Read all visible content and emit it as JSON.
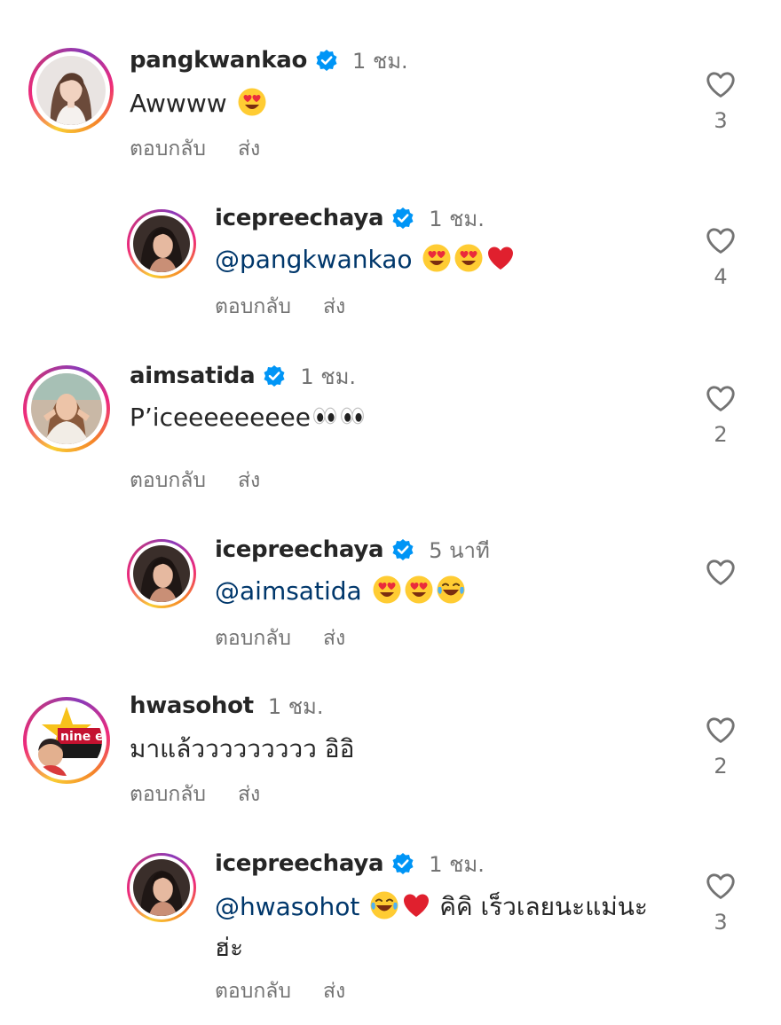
{
  "actions": {
    "reply": "ตอบกลับ",
    "send": "ส่ง"
  },
  "comments": [
    {
      "username": "pangkwankao",
      "verified": true,
      "time": "1 ชม.",
      "text": "Awwww",
      "emojis": [
        "heart-eyes"
      ],
      "likes": "3"
    },
    {
      "username": "icepreechaya",
      "verified": true,
      "time": "1 ชม.",
      "mention": "@pangkwankao",
      "emojis": [
        "heart-eyes",
        "heart-eyes",
        "red-heart"
      ],
      "likes": "4"
    },
    {
      "username": "aimsatida",
      "verified": true,
      "time": "1 ชม.",
      "text": "P’iceeeeeeeee",
      "emojis": [
        "eyes",
        "eyes"
      ],
      "likes": "2"
    },
    {
      "username": "icepreechaya",
      "verified": true,
      "time": "5 นาที",
      "mention": "@aimsatida",
      "emojis": [
        "heart-eyes",
        "heart-eyes",
        "tears-of-joy"
      ],
      "likes": ""
    },
    {
      "username": "hwasohot",
      "verified": false,
      "time": "1 ชม.",
      "text": "มาแล้ววววววววว อิอิ",
      "likes": "2",
      "avatar_text": "nine entert"
    },
    {
      "username": "icepreechaya",
      "verified": true,
      "time": "1 ชม.",
      "mention": "@hwasohot",
      "emojis": [
        "tears-of-joy",
        "red-heart"
      ],
      "text": " คิคิ เร็วเลยนะแม่นะ ฮ่ะ",
      "likes": "3"
    }
  ],
  "colors": {
    "verified_blue": "#0095f6",
    "mention": "#00376b",
    "secondary_text": "#737373"
  }
}
